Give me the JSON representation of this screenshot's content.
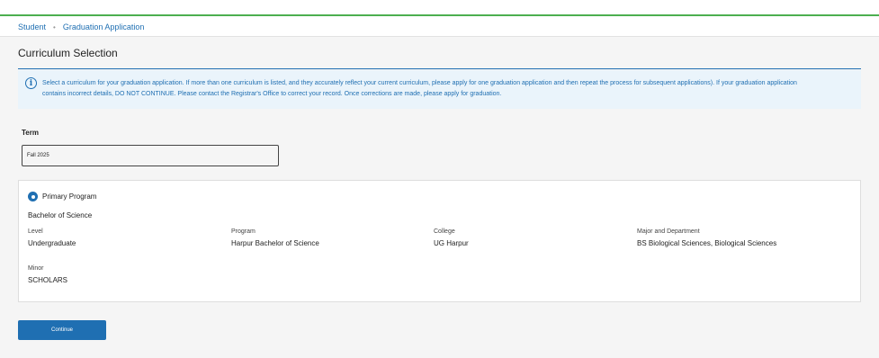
{
  "breadcrumb": {
    "items": [
      "Student",
      "Graduation Application"
    ]
  },
  "page": {
    "title": "Curriculum Selection"
  },
  "alert": {
    "icon": "info-icon",
    "line1": "Select a curriculum for your graduation application. If more than one curriculum is listed, and they accurately reflect your current curriculum, please apply for one graduation application and then repeat the process for subsequent applications). If your graduation application",
    "line2": "contains incorrect details, DO NOT CONTINUE. Please contact the Registrar's Office to correct your record. Once corrections are made, please apply for graduation."
  },
  "term": {
    "label": "Term",
    "value": "Fall 2025"
  },
  "program": {
    "radio_label": "Primary Program",
    "selected": true,
    "degree": "Bachelor of Science",
    "fields": {
      "level": {
        "label": "Level",
        "value": "Undergraduate"
      },
      "program": {
        "label": "Program",
        "value": "Harpur Bachelor of Science"
      },
      "college": {
        "label": "College",
        "value": "UG Harpur"
      },
      "major": {
        "label": "Major and Department",
        "value": "BS Biological Sciences, Biological Sciences"
      },
      "minor": {
        "label": "Minor",
        "value": "SCHOLARS"
      }
    }
  },
  "actions": {
    "continue_label": "Continue"
  },
  "colors": {
    "accent": "#1f6fb2",
    "top_border": "#4caf50",
    "alert_bg": "#eaf4fb"
  }
}
